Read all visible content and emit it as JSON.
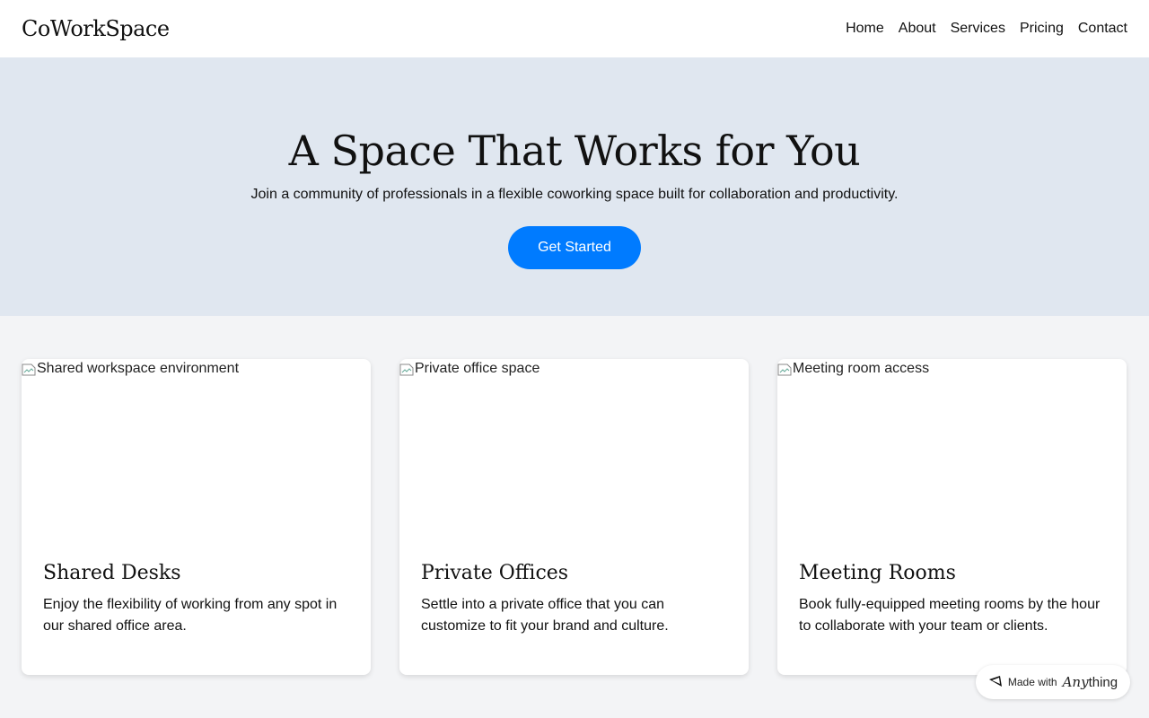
{
  "header": {
    "logo": "CoWorkSpace",
    "nav": [
      "Home",
      "About",
      "Services",
      "Pricing",
      "Contact"
    ]
  },
  "hero": {
    "title": "A Space That Works for You",
    "subtitle": "Join a community of professionals in a flexible coworking space built for collaboration and productivity.",
    "cta_label": "Get Started"
  },
  "cards": [
    {
      "img_alt": "Shared workspace environment",
      "title": "Shared Desks",
      "desc": "Enjoy the flexibility of working from any spot in our shared office area."
    },
    {
      "img_alt": "Private office space",
      "title": "Private Offices",
      "desc": "Settle into a private office that you can customize to fit your brand and culture."
    },
    {
      "img_alt": "Meeting room access",
      "title": "Meeting Rooms",
      "desc": "Book fully-equipped meeting rooms by the hour to collaborate with your team or clients."
    }
  ],
  "badge": {
    "prefix": "Made with",
    "brand_a": "Any",
    "brand_b": "thing",
    "icon": "anything-logo-icon"
  },
  "colors": {
    "hero_bg": "#e0e7f0",
    "accent": "#007bff",
    "page_bg": "#f3f4f6"
  }
}
